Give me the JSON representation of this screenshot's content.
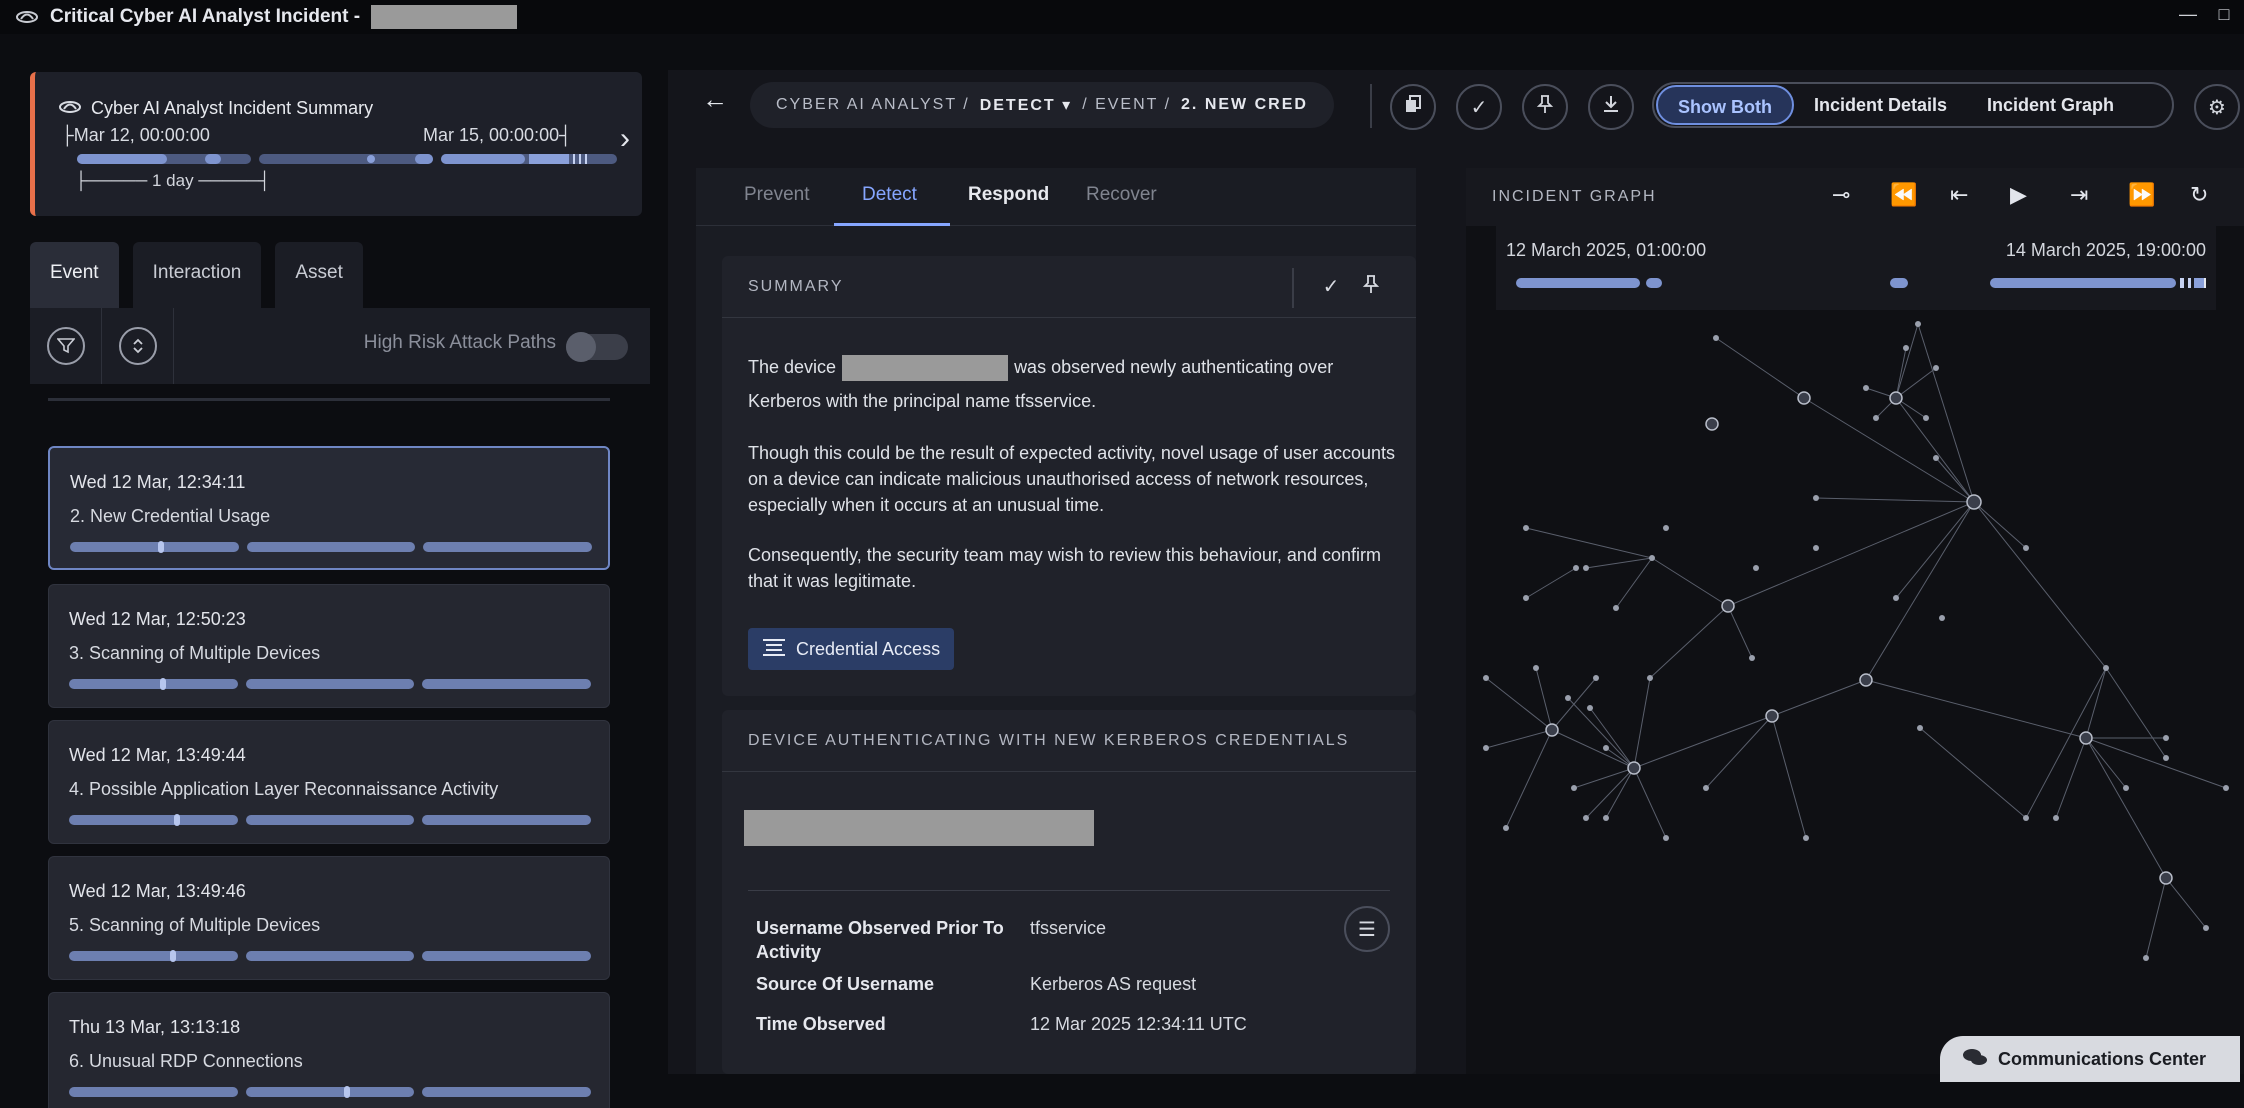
{
  "window": {
    "title": "Critical Cyber AI Analyst Incident - ",
    "minimize": "—",
    "maximize": "□"
  },
  "summary_card": {
    "title": "Cyber AI Analyst Incident Summary",
    "start": "Mar 12, 00:00:00",
    "end": "Mar 15, 00:00:00",
    "scale": "1 day"
  },
  "left_tabs": [
    "Event",
    "Interaction",
    "Asset"
  ],
  "filter": {
    "high_risk_label": "High Risk Attack Paths",
    "high_risk_enabled": false
  },
  "events": [
    {
      "time": "Wed 12 Mar, 12:34:11",
      "name": "2. New Credential Usage",
      "marker_bar": 0,
      "marker_pos": 0.52,
      "selected": true
    },
    {
      "time": "Wed 12 Mar, 12:50:23",
      "name": "3. Scanning of Multiple Devices",
      "marker_bar": 0,
      "marker_pos": 0.54,
      "selected": false
    },
    {
      "time": "Wed 12 Mar, 13:49:44",
      "name": "4. Possible Application Layer Reconnaissance Activity",
      "marker_bar": 0,
      "marker_pos": 0.62,
      "selected": false
    },
    {
      "time": "Wed 12 Mar, 13:49:46",
      "name": "5. Scanning of Multiple Devices",
      "marker_bar": 0,
      "marker_pos": 0.6,
      "selected": false
    },
    {
      "time": "Thu 13 Mar, 13:13:18",
      "name": "6. Unusual RDP Connections",
      "marker_bar": 1,
      "marker_pos": 0.58,
      "selected": false
    }
  ],
  "breadcrumb": {
    "root": "CYBER AI ANALYST /",
    "section": "DETECT",
    "sep": "/ EVENT /",
    "item": "2. NEW CRED"
  },
  "toolbar": {
    "copy_icon": "copy-icon",
    "acknowledge_icon": "check-icon",
    "pin_icon": "pin-icon",
    "download_icon": "download-icon",
    "views": [
      "Show Both",
      "Incident Details",
      "Incident Graph"
    ],
    "active_view": "Show Both",
    "settings_icon": "gear-icon"
  },
  "phase_tabs": [
    "Prevent",
    "Detect",
    "Respond",
    "Recover"
  ],
  "active_phase": "Detect",
  "summary": {
    "heading": "SUMMARY",
    "line1_pre": "The device",
    "line1_post": "was observed newly authenticating over",
    "line2": "Kerberos with the principal name tfsservice.",
    "para2": "Though this could be the result of expected activity, novel usage of user accounts on a device can indicate malicious unauthorised access of network resources, especially when it occurs at an unusual time.",
    "para3": "Consequently, the security team may wish to review this behaviour, and confirm that it was legitimate.",
    "tactic": "Credential Access"
  },
  "device_panel": {
    "heading": "DEVICE AUTHENTICATING WITH NEW KERBEROS CREDENTIALS",
    "rows": [
      {
        "key": "Username Observed Prior To Activity",
        "value": "tfsservice"
      },
      {
        "key": "Source Of Username",
        "value": "Kerberos AS request"
      },
      {
        "key": "Time Observed",
        "value": "12 Mar 2025 12:34:11 UTC"
      }
    ]
  },
  "graph": {
    "heading": "INCIDENT GRAPH",
    "start": "12 March 2025, 01:00:00",
    "end": "14 March 2025, 19:00:00"
  },
  "comm_center": "Communications Center"
}
